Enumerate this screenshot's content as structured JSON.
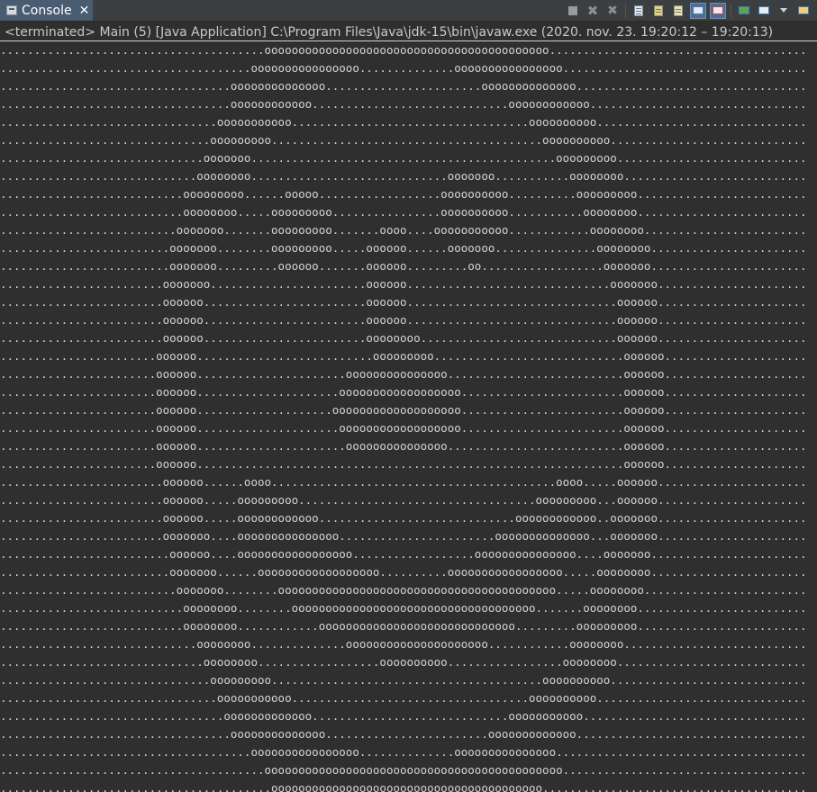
{
  "tab": {
    "label": "Console",
    "close": "✕",
    "icon": "console-icon"
  },
  "toolbar": {
    "buttons": [
      "terminate-icon",
      "remove-launch-icon",
      "remove-all-terminated-icon",
      "scroll-lock-icon",
      "show-on-output-icon",
      "pin-console-icon",
      "word-wrap-icon",
      "show-stdout-icon",
      "show-stderr-icon",
      "open-console-icon",
      "display-console-icon",
      "new-console-icon"
    ]
  },
  "status": "<terminated> Main (5) [Java Application] C:\\Program Files\\Java\\jdk-15\\bin\\javaw.exe  (2020. nov. 23. 19:20:12 – 19:20:13)",
  "output": {
    "char_width": 7.65,
    "runs": [
      [
        [
          39,
          81
        ]
      ],
      [
        [
          37,
          53
        ],
        [
          67,
          83
        ]
      ],
      [
        [
          34,
          48
        ],
        [
          71,
          85
        ]
      ],
      [
        [
          34,
          46
        ],
        [
          75,
          87
        ]
      ],
      [
        [
          32,
          43
        ],
        [
          78,
          88
        ]
      ],
      [
        [
          31,
          40
        ],
        [
          80,
          90
        ]
      ],
      [
        [
          30,
          37
        ],
        [
          82,
          91
        ]
      ],
      [
        [
          29,
          37
        ],
        [
          66,
          73
        ],
        [
          84,
          92
        ]
      ],
      [
        [
          27,
          36
        ],
        [
          42,
          47
        ],
        [
          65,
          75
        ],
        [
          85,
          94
        ]
      ],
      [
        [
          27,
          35
        ],
        [
          40,
          49
        ],
        [
          65,
          75
        ],
        [
          86,
          94
        ]
      ],
      [
        [
          26,
          33
        ],
        [
          40,
          49
        ],
        [
          56,
          60
        ],
        [
          64,
          75
        ],
        [
          87,
          95
        ]
      ],
      [
        [
          25,
          32
        ],
        [
          40,
          49
        ],
        [
          54,
          60
        ],
        [
          66,
          73
        ],
        [
          88,
          96
        ]
      ],
      [
        [
          25,
          32
        ],
        [
          41,
          47
        ],
        [
          54,
          60
        ],
        [
          69,
          71
        ],
        [
          89,
          96
        ]
      ],
      [
        [
          24,
          31
        ],
        [
          54,
          60
        ],
        [
          90,
          97
        ]
      ],
      [
        [
          24,
          30
        ],
        [
          54,
          60
        ],
        [
          91,
          97
        ]
      ],
      [
        [
          24,
          30
        ],
        [
          54,
          60
        ],
        [
          91,
          97
        ]
      ],
      [
        [
          24,
          30
        ],
        [
          54,
          62
        ],
        [
          91,
          97
        ]
      ],
      [
        [
          23,
          29
        ],
        [
          55,
          64
        ],
        [
          92,
          98
        ]
      ],
      [
        [
          23,
          29
        ],
        [
          51,
          66
        ],
        [
          92,
          98
        ]
      ],
      [
        [
          23,
          29
        ],
        [
          50,
          68
        ],
        [
          92,
          98
        ]
      ],
      [
        [
          23,
          29
        ],
        [
          49,
          68
        ],
        [
          92,
          98
        ]
      ],
      [
        [
          23,
          29
        ],
        [
          50,
          68
        ],
        [
          92,
          98
        ]
      ],
      [
        [
          23,
          29
        ],
        [
          51,
          66
        ],
        [
          92,
          98
        ]
      ],
      [
        [
          23,
          29
        ],
        [
          92,
          98
        ]
      ],
      [
        [
          24,
          30
        ],
        [
          36,
          40
        ],
        [
          82,
          86
        ],
        [
          91,
          97
        ]
      ],
      [
        [
          24,
          30
        ],
        [
          35,
          44
        ],
        [
          79,
          88
        ],
        [
          91,
          97
        ]
      ],
      [
        [
          24,
          30
        ],
        [
          35,
          47
        ],
        [
          76,
          88
        ],
        [
          90,
          97
        ]
      ],
      [
        [
          24,
          31
        ],
        [
          35,
          50
        ],
        [
          73,
          87
        ],
        [
          90,
          97
        ]
      ],
      [
        [
          25,
          31
        ],
        [
          35,
          52
        ],
        [
          70,
          85
        ],
        [
          89,
          96
        ]
      ],
      [
        [
          25,
          32
        ],
        [
          38,
          56
        ],
        [
          66,
          83
        ],
        [
          88,
          96
        ]
      ],
      [
        [
          26,
          33
        ],
        [
          41,
          82
        ],
        [
          87,
          95
        ]
      ],
      [
        [
          27,
          35
        ],
        [
          43,
          79
        ],
        [
          86,
          94
        ]
      ],
      [
        [
          27,
          35
        ],
        [
          47,
          76
        ],
        [
          85,
          94
        ]
      ],
      [
        [
          29,
          37
        ],
        [
          51,
          72
        ],
        [
          84,
          92
        ]
      ],
      [
        [
          30,
          38
        ],
        [
          56,
          66
        ],
        [
          83,
          91
        ]
      ],
      [
        [
          31,
          40
        ],
        [
          80,
          90
        ]
      ],
      [
        [
          32,
          43
        ],
        [
          78,
          88
        ]
      ],
      [
        [
          33,
          46
        ],
        [
          75,
          86
        ]
      ],
      [
        [
          34,
          48
        ],
        [
          72,
          85
        ]
      ],
      [
        [
          37,
          53
        ],
        [
          67,
          82
        ]
      ],
      [
        [
          39,
          83
        ]
      ],
      [
        [
          40,
          80
        ]
      ]
    ]
  }
}
